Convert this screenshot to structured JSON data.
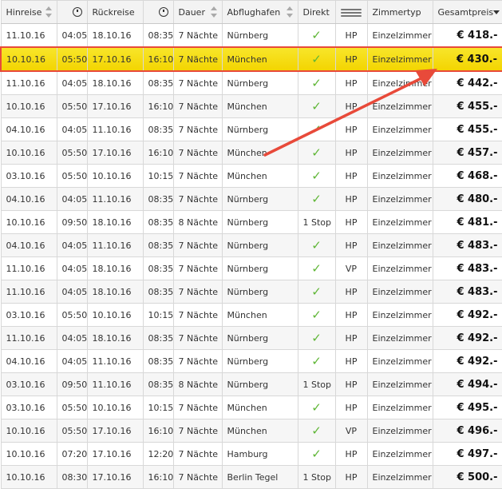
{
  "header": {
    "hinreise": "Hinreise",
    "rueckreise": "Rückreise",
    "dauer": "Dauer",
    "abflughafen": "Abflughafen",
    "direkt": "Direkt",
    "zimmertyp": "Zimmertyp",
    "gesamtpreis": "Gesamtpreis"
  },
  "colors": {
    "highlight": "#f3d400",
    "accent": "#e84a3a",
    "check": "#5fb636"
  },
  "rows": [
    {
      "dep_date": "11.10.16",
      "dep_time": "04:05",
      "ret_date": "18.10.16",
      "ret_time": "08:35",
      "duration": "7 Nächte",
      "airport": "Nürnberg",
      "direct": "✓",
      "board": "HP",
      "room": "Einzelzimmer",
      "price": "€ 418.-"
    },
    {
      "dep_date": "10.10.16",
      "dep_time": "05:50",
      "ret_date": "17.10.16",
      "ret_time": "16:10",
      "duration": "7 Nächte",
      "airport": "München",
      "direct": "✓",
      "board": "HP",
      "room": "Einzelzimmer",
      "price": "€ 430.-",
      "highlight": true
    },
    {
      "dep_date": "11.10.16",
      "dep_time": "04:05",
      "ret_date": "18.10.16",
      "ret_time": "08:35",
      "duration": "7 Nächte",
      "airport": "Nürnberg",
      "direct": "✓",
      "board": "HP",
      "room": "Einzelzimmer",
      "price": "€ 442.-"
    },
    {
      "dep_date": "10.10.16",
      "dep_time": "05:50",
      "ret_date": "17.10.16",
      "ret_time": "16:10",
      "duration": "7 Nächte",
      "airport": "München",
      "direct": "✓",
      "board": "HP",
      "room": "Einzelzimmer",
      "price": "€ 455.-"
    },
    {
      "dep_date": "04.10.16",
      "dep_time": "04:05",
      "ret_date": "11.10.16",
      "ret_time": "08:35",
      "duration": "7 Nächte",
      "airport": "Nürnberg",
      "direct": "✓",
      "board": "HP",
      "room": "Einzelzimmer",
      "price": "€ 455.-"
    },
    {
      "dep_date": "10.10.16",
      "dep_time": "05:50",
      "ret_date": "17.10.16",
      "ret_time": "16:10",
      "duration": "7 Nächte",
      "airport": "München",
      "direct": "✓",
      "board": "HP",
      "room": "Einzelzimmer",
      "price": "€ 457.-"
    },
    {
      "dep_date": "03.10.16",
      "dep_time": "05:50",
      "ret_date": "10.10.16",
      "ret_time": "10:15",
      "duration": "7 Nächte",
      "airport": "München",
      "direct": "✓",
      "board": "HP",
      "room": "Einzelzimmer",
      "price": "€ 468.-"
    },
    {
      "dep_date": "04.10.16",
      "dep_time": "04:05",
      "ret_date": "11.10.16",
      "ret_time": "08:35",
      "duration": "7 Nächte",
      "airport": "Nürnberg",
      "direct": "✓",
      "board": "HP",
      "room": "Einzelzimmer",
      "price": "€ 480.-"
    },
    {
      "dep_date": "10.10.16",
      "dep_time": "09:50",
      "ret_date": "18.10.16",
      "ret_time": "08:35",
      "duration": "8 Nächte",
      "airport": "Nürnberg",
      "direct": "1 Stop",
      "board": "HP",
      "room": "Einzelzimmer",
      "price": "€ 481.-"
    },
    {
      "dep_date": "04.10.16",
      "dep_time": "04:05",
      "ret_date": "11.10.16",
      "ret_time": "08:35",
      "duration": "7 Nächte",
      "airport": "Nürnberg",
      "direct": "✓",
      "board": "HP",
      "room": "Einzelzimmer",
      "price": "€ 483.-"
    },
    {
      "dep_date": "11.10.16",
      "dep_time": "04:05",
      "ret_date": "18.10.16",
      "ret_time": "08:35",
      "duration": "7 Nächte",
      "airport": "Nürnberg",
      "direct": "✓",
      "board": "VP",
      "room": "Einzelzimmer",
      "price": "€ 483.-"
    },
    {
      "dep_date": "11.10.16",
      "dep_time": "04:05",
      "ret_date": "18.10.16",
      "ret_time": "08:35",
      "duration": "7 Nächte",
      "airport": "Nürnberg",
      "direct": "✓",
      "board": "HP",
      "room": "Einzelzimmer",
      "price": "€ 483.-"
    },
    {
      "dep_date": "03.10.16",
      "dep_time": "05:50",
      "ret_date": "10.10.16",
      "ret_time": "10:15",
      "duration": "7 Nächte",
      "airport": "München",
      "direct": "✓",
      "board": "HP",
      "room": "Einzelzimmer",
      "price": "€ 492.-"
    },
    {
      "dep_date": "11.10.16",
      "dep_time": "04:05",
      "ret_date": "18.10.16",
      "ret_time": "08:35",
      "duration": "7 Nächte",
      "airport": "Nürnberg",
      "direct": "✓",
      "board": "HP",
      "room": "Einzelzimmer",
      "price": "€ 492.-"
    },
    {
      "dep_date": "04.10.16",
      "dep_time": "04:05",
      "ret_date": "11.10.16",
      "ret_time": "08:35",
      "duration": "7 Nächte",
      "airport": "Nürnberg",
      "direct": "✓",
      "board": "HP",
      "room": "Einzelzimmer",
      "price": "€ 492.-"
    },
    {
      "dep_date": "03.10.16",
      "dep_time": "09:50",
      "ret_date": "11.10.16",
      "ret_time": "08:35",
      "duration": "8 Nächte",
      "airport": "Nürnberg",
      "direct": "1 Stop",
      "board": "HP",
      "room": "Einzelzimmer",
      "price": "€ 494.-"
    },
    {
      "dep_date": "03.10.16",
      "dep_time": "05:50",
      "ret_date": "10.10.16",
      "ret_time": "10:15",
      "duration": "7 Nächte",
      "airport": "München",
      "direct": "✓",
      "board": "HP",
      "room": "Einzelzimmer",
      "price": "€ 495.-"
    },
    {
      "dep_date": "10.10.16",
      "dep_time": "05:50",
      "ret_date": "17.10.16",
      "ret_time": "16:10",
      "duration": "7 Nächte",
      "airport": "München",
      "direct": "✓",
      "board": "VP",
      "room": "Einzelzimmer",
      "price": "€ 496.-"
    },
    {
      "dep_date": "10.10.16",
      "dep_time": "07:20",
      "ret_date": "17.10.16",
      "ret_time": "12:20",
      "duration": "7 Nächte",
      "airport": "Hamburg",
      "direct": "✓",
      "board": "HP",
      "room": "Einzelzimmer",
      "price": "€ 497.-"
    },
    {
      "dep_date": "10.10.16",
      "dep_time": "08:30",
      "ret_date": "17.10.16",
      "ret_time": "16:10",
      "duration": "7 Nächte",
      "airport": "Berlin Tegel",
      "direct": "1 Stop",
      "board": "HP",
      "room": "Einzelzimmer",
      "price": "€ 500.-"
    }
  ]
}
